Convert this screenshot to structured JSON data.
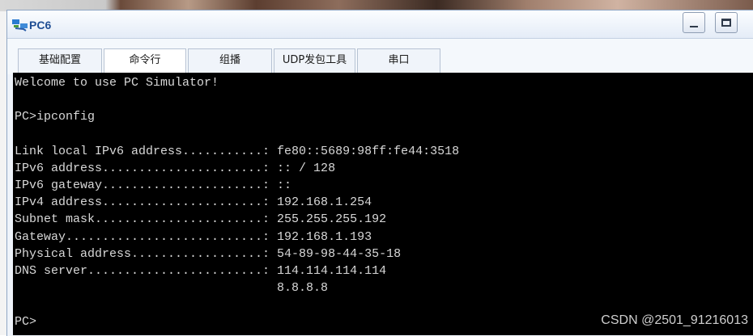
{
  "window": {
    "title": "PC6"
  },
  "tabs": [
    {
      "label": "基础配置"
    },
    {
      "label": "命令行"
    },
    {
      "label": "组播"
    },
    {
      "label": "UDP发包工具"
    },
    {
      "label": "串口"
    }
  ],
  "terminal": {
    "lines": [
      "Welcome to use PC Simulator!",
      "",
      "PC>ipconfig",
      "",
      "Link local IPv6 address...........: fe80::5689:98ff:fe44:3518",
      "IPv6 address......................: :: / 128",
      "IPv6 gateway......................: ::",
      "IPv4 address......................: 192.168.1.254",
      "Subnet mask.......................: 255.255.255.192",
      "Gateway...........................: 192.168.1.193",
      "Physical address..................: 54-89-98-44-35-18",
      "DNS server........................: 114.114.114.114",
      "                                    8.8.8.8",
      "",
      "",
      "PC>"
    ]
  },
  "watermark": "CSDN @2501_91216013"
}
